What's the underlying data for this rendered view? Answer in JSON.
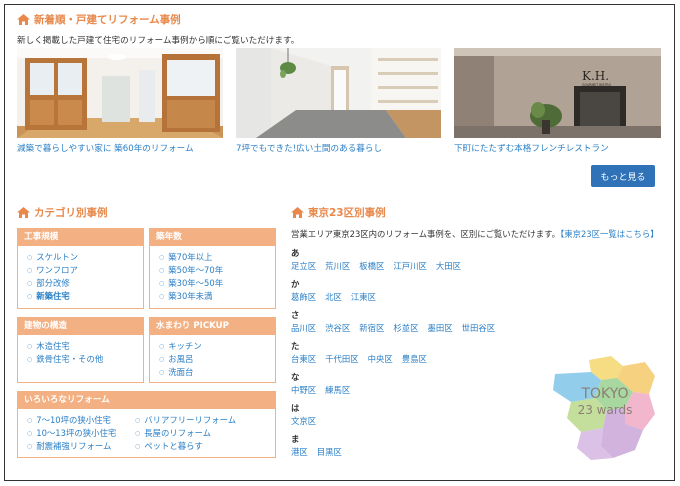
{
  "new_section": {
    "title": "新着順・戸建てリフォーム事例",
    "lead": "新しく掲載した戸建て住宅のリフォーム事例から順にご覧いただけます。",
    "cases": [
      {
        "caption": "減築で暮らしやすい家に 築60年のリフォーム"
      },
      {
        "caption": "7坪でもできた!広い土間のある暮らし"
      },
      {
        "caption": "下町にたたずむ本格フレンチレストラン"
      }
    ],
    "sign_text": "K.H.",
    "sign_sub": "GOURMET BISTRO",
    "more_label": "もっと見る"
  },
  "category_section": {
    "title": "カテゴリ別事例",
    "cards": {
      "scale": {
        "header": "工事規模",
        "items": [
          "スケルトン",
          "ワンフロア",
          "部分改修",
          "新築住宅"
        ]
      },
      "age": {
        "header": "築年数",
        "items": [
          "築70年以上",
          "築50年〜70年",
          "築30年〜50年",
          "築30年未満"
        ]
      },
      "structure": {
        "header": "建物の構造",
        "items": [
          "木造住宅",
          "鉄骨住宅・その他"
        ]
      },
      "water": {
        "header": "水まわり PICKUP",
        "items": [
          "キッチン",
          "お風呂",
          "洗面台"
        ]
      },
      "various": {
        "header": "いろいろなリフォーム",
        "left": [
          "7〜10坪の狭小住宅",
          "10〜13坪の狭小住宅",
          "耐震補強リフォーム"
        ],
        "right": [
          "バリアフリーリフォーム",
          "長屋のリフォーム",
          "ペットと暮らす"
        ]
      }
    }
  },
  "ward_section": {
    "title": "東京23区別事例",
    "lead": "営業エリア東京23区内のリフォーム事例を、区別にご覧いただけます。",
    "lead_link": "【東京23区一覧はこちら】",
    "groups": [
      {
        "kana": "あ",
        "wards": [
          "足立区",
          "荒川区",
          "板橋区",
          "江戸川区",
          "大田区"
        ]
      },
      {
        "kana": "か",
        "wards": [
          "葛飾区",
          "北区",
          "江東区"
        ]
      },
      {
        "kana": "さ",
        "wards": [
          "品川区",
          "渋谷区",
          "新宿区",
          "杉並区",
          "墨田区",
          "世田谷区"
        ]
      },
      {
        "kana": "た",
        "wards": [
          "台東区",
          "千代田区",
          "中央区",
          "豊島区"
        ]
      },
      {
        "kana": "な",
        "wards": [
          "中野区",
          "練馬区"
        ]
      },
      {
        "kana": "は",
        "wards": [
          "文京区"
        ]
      },
      {
        "kana": "ま",
        "wards": [
          "港区",
          "目黒区"
        ]
      }
    ],
    "map_text_1": "TOKYO",
    "map_text_2": "23 wards"
  },
  "colors": {
    "accent": "#e8884a",
    "card_header": "#f3b183",
    "link": "#2a7fc6",
    "button": "#2f72b8"
  }
}
